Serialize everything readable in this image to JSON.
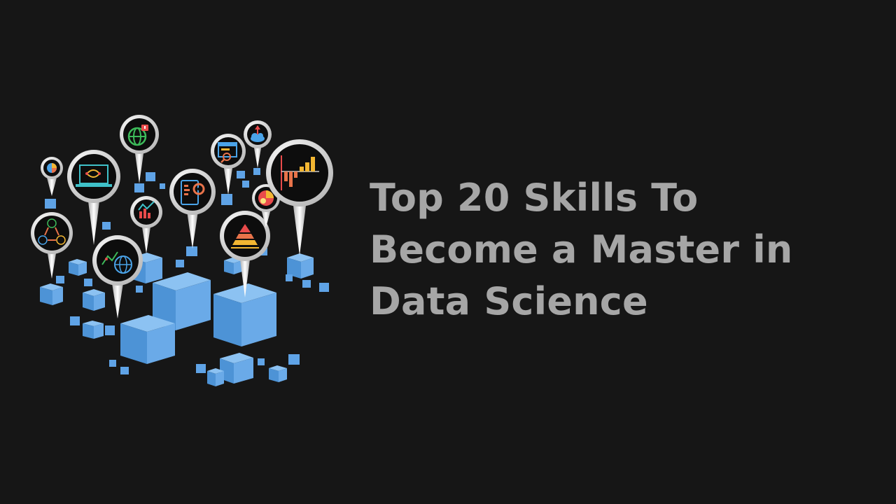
{
  "slide": {
    "title_lines": [
      "Top 20 Skills To",
      "Become a Master in",
      "Data Science"
    ]
  },
  "theme": {
    "background": "#161616",
    "title_color": "#a6a6a6",
    "cube_light": "#7fb8ee",
    "cube_mid": "#5a9fe0",
    "cube_dark": "#3f82c8",
    "pin_ring": "#ffffff",
    "pin_face": "#0d0d0d"
  },
  "illustration": {
    "icons": [
      "pie-chart-icon",
      "laptop-flow-icon",
      "globe-alert-icon",
      "cycle-abc-icon",
      "line-chart-icon",
      "globe-trend-icon",
      "tablet-gear-icon",
      "browser-search-icon",
      "cloud-upload-icon",
      "pyramid-chart-icon",
      "pie-gauge-icon",
      "bar-chart-icon"
    ]
  }
}
